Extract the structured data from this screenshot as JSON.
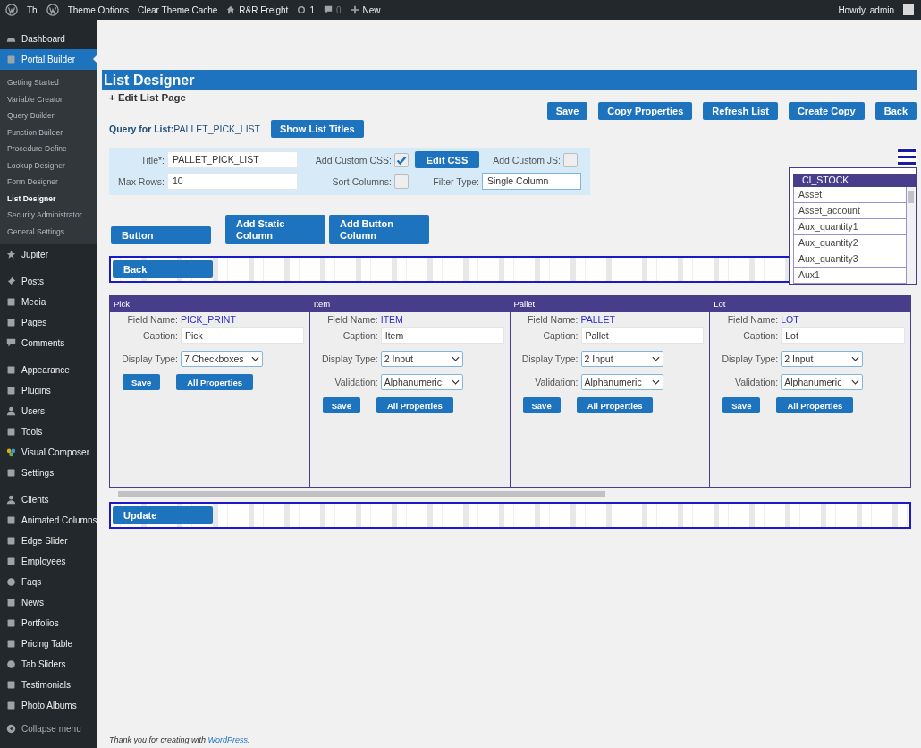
{
  "admin_bar": {
    "left": [
      {
        "kind": "logo"
      },
      {
        "kind": "link",
        "label": "Th"
      },
      {
        "kind": "logo"
      },
      {
        "kind": "link",
        "label": "Theme Options"
      },
      {
        "kind": "link",
        "label": "Clear Theme Cache"
      },
      {
        "kind": "home",
        "label": "R&R Freight"
      },
      {
        "kind": "updates",
        "label": "1"
      },
      {
        "kind": "comments",
        "label": "0"
      },
      {
        "kind": "new",
        "label": "New"
      }
    ],
    "greeting": "Howdy, admin"
  },
  "sidebar": {
    "groups": [
      {
        "items": [
          {
            "label": "Dashboard",
            "selected": false
          },
          {
            "label": "Portal Builder",
            "selected": true,
            "children": [
              {
                "label": "Getting Started",
                "selected": false
              },
              {
                "label": "Variable Creator",
                "selected": false
              },
              {
                "label": "Query Builder",
                "selected": false
              },
              {
                "label": "Function Builder",
                "selected": false
              },
              {
                "label": "Procedure Define",
                "selected": false
              },
              {
                "label": "Lookup Designer",
                "selected": false
              },
              {
                "label": "Form Designer",
                "selected": false
              },
              {
                "label": "List Designer",
                "selected": true
              },
              {
                "label": "Security Administrator",
                "selected": false
              },
              {
                "label": "General Settings",
                "selected": false
              }
            ]
          },
          {
            "label": "Jupiter",
            "selected": false
          }
        ]
      },
      {
        "items": [
          {
            "label": "Posts",
            "selected": false
          },
          {
            "label": "Media",
            "selected": false
          },
          {
            "label": "Pages",
            "selected": false
          },
          {
            "label": "Comments",
            "selected": false
          }
        ]
      },
      {
        "items": [
          {
            "label": "Appearance",
            "selected": false
          },
          {
            "label": "Plugins",
            "selected": false
          },
          {
            "label": "Users",
            "selected": false
          },
          {
            "label": "Tools",
            "selected": false
          },
          {
            "label": "Visual Composer",
            "selected": false
          },
          {
            "label": "Settings",
            "selected": false
          }
        ]
      },
      {
        "items": [
          {
            "label": "Clients",
            "selected": false
          },
          {
            "label": "Animated Columns",
            "selected": false
          },
          {
            "label": "Edge Slider",
            "selected": false
          },
          {
            "label": "Employees",
            "selected": false
          },
          {
            "label": "Faqs",
            "selected": false
          },
          {
            "label": "News",
            "selected": false
          },
          {
            "label": "Portfolios",
            "selected": false
          },
          {
            "label": "Pricing Table",
            "selected": false
          },
          {
            "label": "Tab Sliders",
            "selected": false
          },
          {
            "label": "Testimonials",
            "selected": false
          },
          {
            "label": "Photo Albums",
            "selected": false
          }
        ]
      }
    ],
    "collapse": "Collapse menu"
  },
  "page": {
    "title": "List Designer",
    "subtitle": "+ Edit List Page",
    "actions": [
      "Save",
      "Copy Properties",
      "Refresh List",
      "Create Copy",
      "Back"
    ],
    "query_label": "Query for List:",
    "query_value": "PALLET_PICK_LIST",
    "show_titles_button": "Show List Titles"
  },
  "settings": {
    "title": {
      "label": "Title*:",
      "value": "PALLET_PICK_LIST"
    },
    "add_custom_css": {
      "label": "Add Custom CSS:",
      "checked": true
    },
    "edit_css_button": "Edit CSS",
    "add_custom_js": {
      "label": "Add Custom JS:",
      "checked": false
    },
    "max_rows": {
      "label": "Max Rows:",
      "value": "10"
    },
    "sort_columns": {
      "label": "Sort Columns:",
      "checked": false
    },
    "filter_type": {
      "label": "Filter Type:",
      "value": "Single Column"
    }
  },
  "add_buttons": [
    "Button",
    "Add Static Column",
    "Add Button Column"
  ],
  "top_bar_button": "Back",
  "field_list": {
    "title": "CI_STOCK",
    "items": [
      "Asset",
      "Asset_account",
      "Aux_quantity1",
      "Aux_quantity2",
      "Aux_quantity3",
      "Aux1"
    ]
  },
  "columns": [
    {
      "header": "Pick",
      "fields": [
        {
          "kind": "text",
          "label": "Field Name:",
          "value": "PICK_PRINT"
        },
        {
          "kind": "input",
          "label": "Caption:",
          "value": "Pick"
        },
        {
          "kind": "select",
          "label": "Display Type:",
          "value": "7 Checkboxes"
        }
      ],
      "buttons": [
        "Save",
        "All Properties"
      ]
    },
    {
      "header": "Item",
      "fields": [
        {
          "kind": "text",
          "label": "Field Name:",
          "value": "ITEM"
        },
        {
          "kind": "input",
          "label": "Caption:",
          "value": "Item"
        },
        {
          "kind": "select",
          "label": "Display Type:",
          "value": "2 Input"
        },
        {
          "kind": "select",
          "label": "Validation:",
          "value": "Alphanumeric"
        }
      ],
      "buttons": [
        "Save",
        "All Properties"
      ]
    },
    {
      "header": "Pallet",
      "fields": [
        {
          "kind": "text",
          "label": "Field Name:",
          "value": "PALLET"
        },
        {
          "kind": "input",
          "label": "Caption:",
          "value": "Pallet"
        },
        {
          "kind": "select",
          "label": "Display Type:",
          "value": "2 Input"
        },
        {
          "kind": "select",
          "label": "Validation:",
          "value": "Alphanumeric"
        }
      ],
      "buttons": [
        "Save",
        "All Properties"
      ]
    },
    {
      "header": "Lot",
      "fields": [
        {
          "kind": "text",
          "label": "Field Name:",
          "value": "LOT"
        },
        {
          "kind": "input",
          "label": "Caption:",
          "value": "Lot"
        },
        {
          "kind": "select",
          "label": "Display Type:",
          "value": "2 Input"
        },
        {
          "kind": "select",
          "label": "Validation:",
          "value": "Alphanumeric"
        }
      ],
      "buttons": [
        "Save",
        "All Properties"
      ]
    }
  ],
  "bottom_bar_button": "Update",
  "footer": {
    "text": "Thank you for creating with ",
    "link": "WordPress",
    "end": "."
  }
}
